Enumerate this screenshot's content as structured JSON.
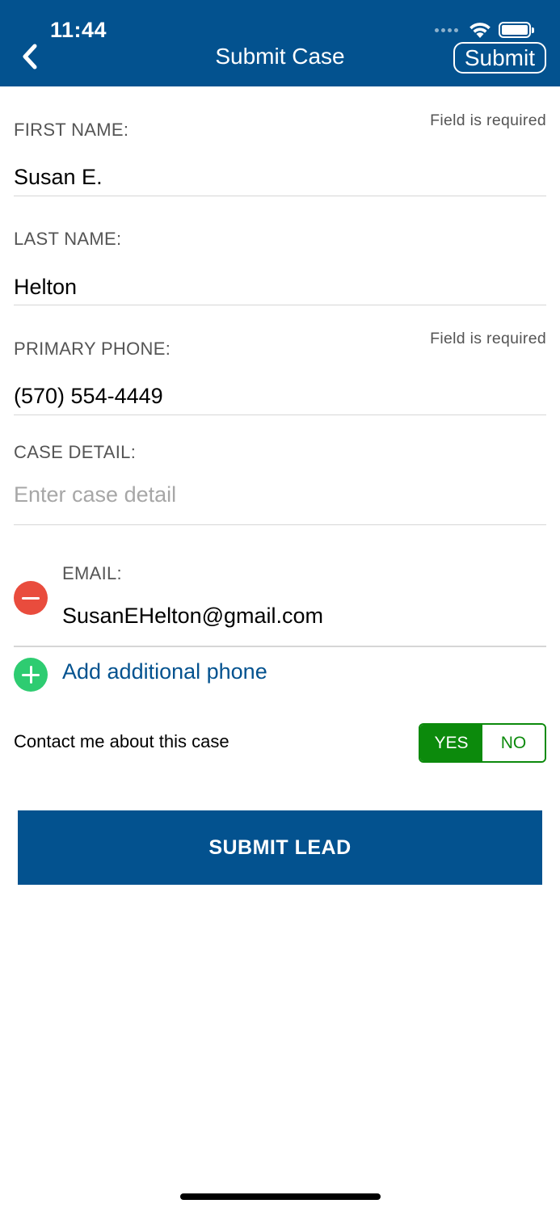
{
  "status_bar": {
    "time": "11:44"
  },
  "nav": {
    "title": "Submit Case",
    "submit_label": "Submit",
    "back_icon": "chevron-left-icon"
  },
  "form": {
    "first_name": {
      "label": "FIRST NAME:",
      "required_note": "Field is required",
      "value": "Susan E."
    },
    "last_name": {
      "label": "LAST NAME:",
      "value": "Helton"
    },
    "primary_phone": {
      "label": "PRIMARY PHONE:",
      "required_note": "Field is required",
      "value": "(570) 554-4449"
    },
    "case_detail": {
      "label": "CASE DETAIL:",
      "placeholder": "Enter case detail",
      "value": ""
    },
    "email": {
      "label": "EMAIL:",
      "value": "SusanEHelton@gmail.com"
    },
    "add_phone_label": "Add additional phone",
    "contact": {
      "label": "Contact me about this case",
      "yes_label": "YES",
      "no_label": "NO",
      "selected": "YES"
    },
    "submit_lead_label": "SUBMIT LEAD"
  },
  "colors": {
    "brand_blue": "#03528f",
    "toggle_green": "#0c8a0c",
    "remove_red": "#e94c3d",
    "add_green": "#2ecc71"
  }
}
